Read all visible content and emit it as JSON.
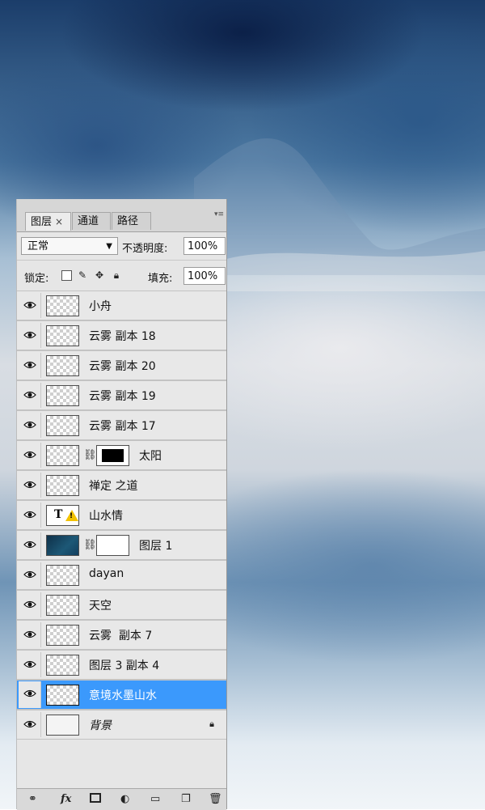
{
  "colors": {
    "selection": "#3b99fc",
    "panel": "#e6e6e6"
  },
  "tabs": [
    {
      "label": "图层",
      "close": "×"
    },
    {
      "label": "通道"
    },
    {
      "label": "路径"
    }
  ],
  "blend_mode": "正常",
  "opacity_label": "不透明度:",
  "opacity_value": "100%",
  "lock_label": "锁定:",
  "fill_label": "填充:",
  "fill_value": "100%",
  "layers": [
    {
      "name": "小舟"
    },
    {
      "name": "云雾 副本 18"
    },
    {
      "name": "云雾 副本 20"
    },
    {
      "name": "云雾 副本 19"
    },
    {
      "name": "云雾 副本 17"
    },
    {
      "name": "太阳"
    },
    {
      "name": "禅定 之道"
    },
    {
      "name": "山水情",
      "text_glyph": "T"
    },
    {
      "name": "图层 1"
    },
    {
      "name": "dayan"
    },
    {
      "name": "天空"
    },
    {
      "name": "云雾  副本 7"
    },
    {
      "name": "图层 3 副本 4"
    },
    {
      "name": "意境水墨山水",
      "selected": true
    },
    {
      "name": "背景",
      "locked": true
    }
  ],
  "bottom_icons": [
    "link-icon",
    "fx-icon",
    "mask-icon",
    "adjustment-icon",
    "folder-icon",
    "new-layer-icon",
    "trash-icon"
  ],
  "fx_text": "fx"
}
